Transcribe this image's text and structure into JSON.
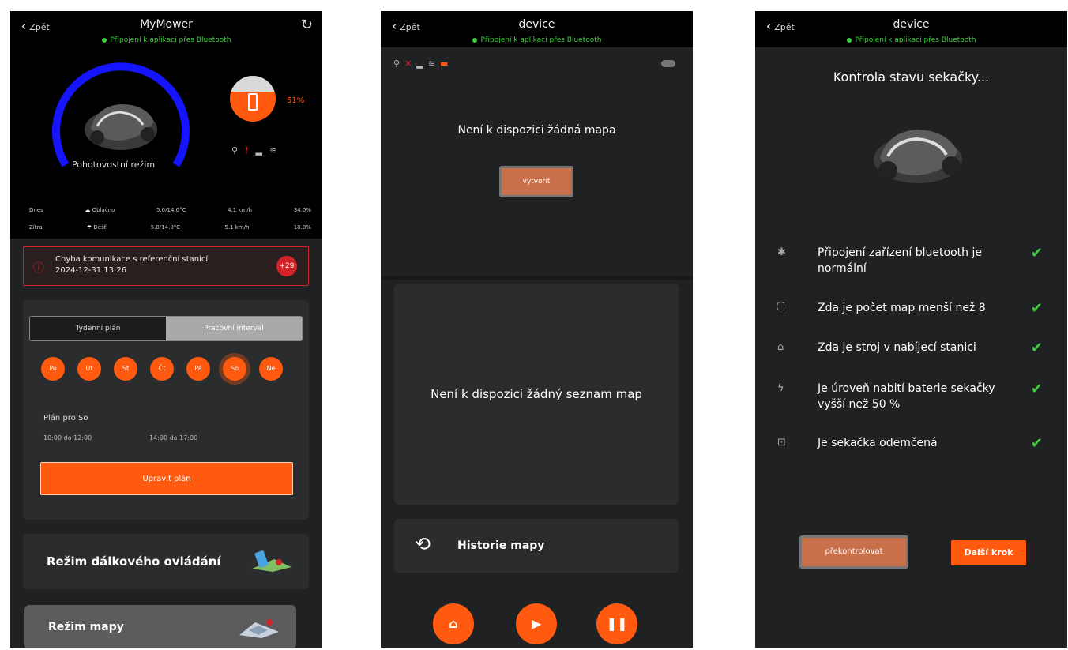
{
  "colors": {
    "accent": "#ff5a0f",
    "connected": "#3ecf3e",
    "error": "#d2232a",
    "gauge": "#1414ff",
    "check": "#3ecf3e"
  },
  "screen1": {
    "back_label": "Zpět",
    "title": "MyMower",
    "status": "Připojení k aplikaci přes Bluetooth",
    "mode_label": "Pohotovostní režim",
    "battery_percent": "51%",
    "battery_level": 0.51,
    "weather": [
      {
        "day": "Dnes",
        "cond": "Oblačno",
        "temp": "5.0/14.0°C",
        "wind": "4.1 km/h",
        "rain": "34.0%"
      },
      {
        "day": "Zítra",
        "cond": "Déšť",
        "temp": "5.0/14.0°C",
        "wind": "5.1 km/h",
        "rain": "18.0%"
      }
    ],
    "alert": {
      "title": "Chyba komunikace s referenční stanicí",
      "date": "2024-12-31 13:26",
      "badge": "+29"
    },
    "tabs": [
      "Týdenní plán",
      "Pracovní interval"
    ],
    "days": [
      "Po",
      "Út",
      "St",
      "Čt",
      "Pá",
      "So",
      "Ne"
    ],
    "plan_for": "Plán pro So",
    "slots": [
      "10:00 do 12:00",
      "14:00 do 17:00"
    ],
    "edit_button": "Upravit plán",
    "remote_mode": "Režim dálkového ovládání",
    "map_mode": "Režim mapy"
  },
  "screen2": {
    "back_label": "Zpět",
    "title": "device",
    "status": "Připojení k aplikaci přes Bluetooth",
    "no_map": "Není k dispozici žádná mapa",
    "create_button": "vytvořit",
    "no_map_list": "Není k dispozici žádný seznam map",
    "history": "Historie mapy"
  },
  "screen3": {
    "back_label": "Zpět",
    "title": "device",
    "status": "Připojení k aplikaci přes Bluetooth",
    "heading": "Kontrola stavu sekačky...",
    "checks": [
      {
        "icon": "bluetooth-icon",
        "text": "Připojení zařízení bluetooth je normální"
      },
      {
        "icon": "map-icon",
        "text": "Zda je počet map menší než 8"
      },
      {
        "icon": "station-icon",
        "text": "Zda je stroj v nabíjecí stanici"
      },
      {
        "icon": "bolt-icon",
        "text": "Je úroveň nabití baterie sekačky vyšší než 50 %"
      },
      {
        "icon": "lock-icon",
        "text": "Je sekačka odemčená"
      }
    ],
    "recheck_button": "překontrolovat",
    "next_button": "Další krok"
  }
}
